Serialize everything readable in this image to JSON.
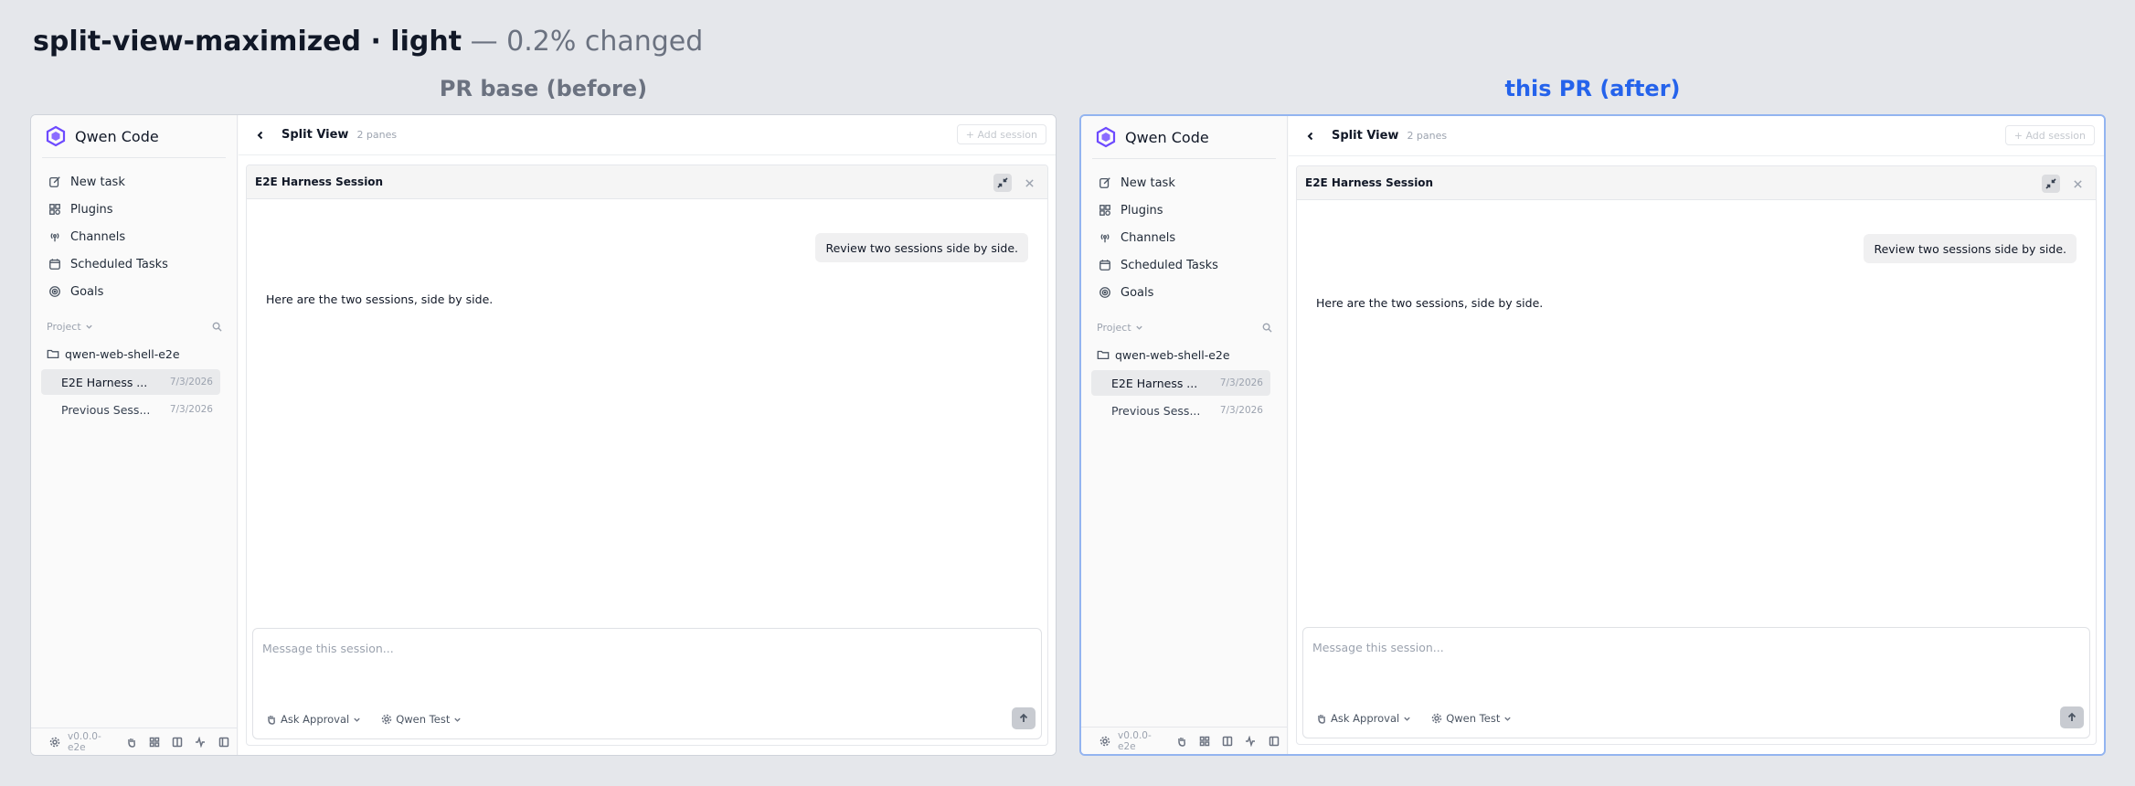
{
  "header": {
    "title": "split-view-maximized · light",
    "suffix": " — 0.2% changed"
  },
  "panels": [
    {
      "caption": "PR base (before)",
      "app": {
        "brand": "Qwen Code",
        "nav": [
          "New task",
          "Plugins",
          "Channels",
          "Scheduled Tasks",
          "Goals"
        ],
        "project_label": "Project",
        "folder": "qwen-web-shell-e2e",
        "sessions": [
          {
            "name": "E2E Harness ...",
            "date": "7/3/2026"
          },
          {
            "name": "Previous Sess...",
            "date": "7/3/2026"
          }
        ],
        "version": "v0.0.0-e2e",
        "view_title": "Split View",
        "view_sub": "2 panes",
        "add_session": "+ Add session",
        "pane_title": "E2E Harness Session",
        "user_message": "Review two sessions side by side.",
        "assistant_message": "Here are the two sessions, side by side.",
        "composer_placeholder": "Message this session...",
        "approval": "Ask Approval",
        "model": "Qwen Test"
      }
    },
    {
      "caption": "this PR (after)",
      "app": {
        "brand": "Qwen Code",
        "nav": [
          "New task",
          "Plugins",
          "Channels",
          "Scheduled Tasks",
          "Goals"
        ],
        "project_label": "Project",
        "folder": "qwen-web-shell-e2e",
        "sessions": [
          {
            "name": "E2E Harness ...",
            "date": "7/3/2026"
          },
          {
            "name": "Previous Sess...",
            "date": "7/3/2026"
          }
        ],
        "version": "v0.0.0-e2e",
        "view_title": "Split View",
        "view_sub": "2 panes",
        "add_session": "+ Add session",
        "pane_title": "E2E Harness Session",
        "user_message": "Review two sessions side by side.",
        "assistant_message": "Here are the two sessions, side by side.",
        "composer_placeholder": "Message this session...",
        "approval": "Ask Approval",
        "model": "Qwen Test"
      }
    }
  ]
}
